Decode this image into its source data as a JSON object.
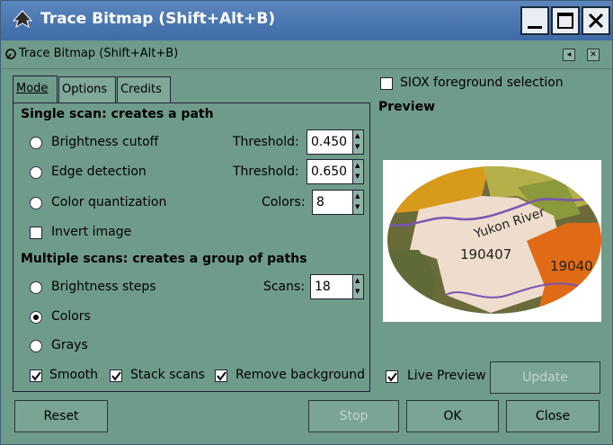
{
  "window": {
    "title": "Trace Bitmap (Shift+Alt+B)"
  },
  "dock": {
    "title": "Trace Bitmap (Shift+Alt+B)"
  },
  "tabs": [
    {
      "label": "Mode",
      "active": true
    },
    {
      "label": "Options",
      "active": false
    },
    {
      "label": "Credits",
      "active": false
    }
  ],
  "single_scan": {
    "heading": "Single scan: creates a path",
    "brightness_label": "Brightness cutoff",
    "brightness_threshold_label": "Threshold:",
    "brightness_threshold_value": "0.450",
    "edge_label": "Edge detection",
    "edge_threshold_label": "Threshold:",
    "edge_threshold_value": "0.650",
    "color_quant_label": "Color quantization",
    "colors_label": "Colors:",
    "colors_value": "8",
    "invert_label": "Invert image"
  },
  "multi_scan": {
    "heading": "Multiple scans: creates a group of paths",
    "brightness_steps_label": "Brightness steps",
    "scans_label": "Scans:",
    "scans_value": "18",
    "colors_label": "Colors",
    "grays_label": "Grays",
    "smooth_label": "Smooth",
    "stack_label": "Stack scans",
    "remove_bg_label": "Remove background"
  },
  "siox_label": "SIOX foreground selection",
  "preview": {
    "title": "Preview",
    "map_labels": {
      "river": "Yukon River",
      "code1": "190407",
      "code2": "19040"
    }
  },
  "live_preview_label": "Live Preview",
  "buttons": {
    "update": "Update",
    "reset": "Reset",
    "stop": "Stop",
    "ok": "OK",
    "close": "Close"
  },
  "colors": {
    "dialog_bg": "#6f9b8b",
    "titlebar": "#4a76b0",
    "button_bg": "#7aa493"
  }
}
